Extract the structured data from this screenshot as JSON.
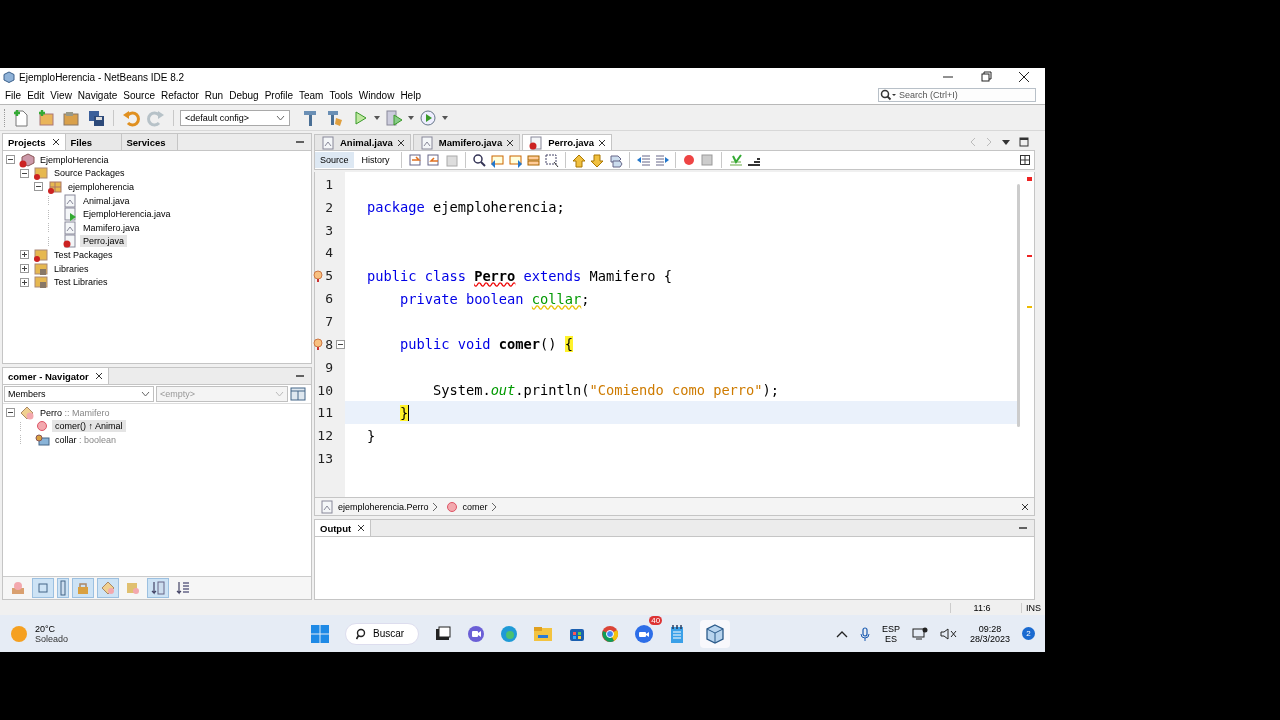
{
  "window": {
    "title": "EjemploHerencia - NetBeans IDE 8.2"
  },
  "menu": [
    "File",
    "Edit",
    "View",
    "Navigate",
    "Source",
    "Refactor",
    "Run",
    "Debug",
    "Profile",
    "Team",
    "Tools",
    "Window",
    "Help"
  ],
  "toolbar": {
    "config": "<default config>",
    "search_placeholder": "Search (Ctrl+I)"
  },
  "projects_panel": {
    "tabs": [
      {
        "label": "Projects",
        "selected": true,
        "closable": true
      },
      {
        "label": "Files",
        "selected": false,
        "closable": false
      },
      {
        "label": "Services",
        "selected": false,
        "closable": false
      }
    ],
    "tree": [
      {
        "label": "EjemploHerencia",
        "kind": "project",
        "expanded": true,
        "selected": false,
        "children": [
          {
            "label": "Source Packages",
            "kind": "folder",
            "expanded": true,
            "selected": false,
            "children": [
              {
                "label": "ejemploherencia",
                "kind": "package",
                "expanded": true,
                "selected": false,
                "children": [
                  {
                    "label": "Animal.java",
                    "kind": "class",
                    "selected": false
                  },
                  {
                    "label": "EjemploHerencia.java",
                    "kind": "main",
                    "selected": false
                  },
                  {
                    "label": "Mamifero.java",
                    "kind": "class",
                    "selected": false
                  },
                  {
                    "label": "Perro.java",
                    "kind": "error",
                    "selected": true
                  }
                ]
              }
            ]
          },
          {
            "label": "Test Packages",
            "kind": "folder",
            "expanded": false,
            "selected": false
          },
          {
            "label": "Libraries",
            "kind": "library",
            "expanded": false,
            "selected": false
          },
          {
            "label": "Test Libraries",
            "kind": "library",
            "expanded": false,
            "selected": false
          }
        ]
      }
    ]
  },
  "navigator": {
    "title": "comer - Navigator",
    "filter": "Members",
    "filter_placeholder": "<empty>",
    "tree": [
      {
        "name": "Perro",
        "detail": " :: Mamifero",
        "kind": "class",
        "expanded": true,
        "selected": false,
        "children": [
          {
            "name": "comer() ↑ Animal",
            "kind": "method",
            "selected": true
          },
          {
            "name": "collar",
            "detail": " : boolean",
            "kind": "field",
            "selected": false
          }
        ]
      }
    ]
  },
  "editor": {
    "tabs": [
      {
        "label": "Animal.java",
        "kind": "class",
        "selected": false
      },
      {
        "label": "Mamifero.java",
        "kind": "class",
        "selected": false
      },
      {
        "label": "Perro.java",
        "kind": "error",
        "selected": true
      }
    ],
    "views": [
      {
        "label": "Source",
        "selected": true
      },
      {
        "label": "History",
        "selected": false
      }
    ],
    "lines": [
      {
        "n": "1"
      },
      {
        "n": "2",
        "tokens": [
          {
            "text": "package",
            "kind": "kw"
          },
          {
            "text": " ejemploherencia;",
            "kind": "plain"
          }
        ]
      },
      {
        "n": "3"
      },
      {
        "n": "4"
      },
      {
        "n": "5",
        "override_marker": true,
        "tokens": [
          {
            "text": "public class ",
            "kind": "kw"
          },
          {
            "text": "Perro",
            "kind": "error"
          },
          {
            "text": " extends",
            "kind": "kw"
          },
          {
            "text": " Mamifero {",
            "kind": "plain"
          }
        ]
      },
      {
        "n": "6",
        "tokens": [
          {
            "text": "    private boolean ",
            "kind": "kw"
          },
          {
            "text": "collar",
            "kind": "field"
          },
          {
            "text": ";",
            "kind": "plain"
          }
        ]
      },
      {
        "n": "7"
      },
      {
        "n": "8",
        "override_marker": true,
        "fold": true,
        "tokens": [
          {
            "text": "    public void ",
            "kind": "kw"
          },
          {
            "text": "comer",
            "kind": "decl"
          },
          {
            "text": "() ",
            "kind": "plain"
          },
          {
            "text": "{",
            "kind": "match"
          }
        ]
      },
      {
        "n": "9"
      },
      {
        "n": "10",
        "tokens": [
          {
            "text": "        System.",
            "kind": "plain"
          },
          {
            "text": "out",
            "kind": "static"
          },
          {
            "text": ".println(",
            "kind": "plain"
          },
          {
            "text": "\"Comiendo como perro\"",
            "kind": "str"
          },
          {
            "text": ");",
            "kind": "plain"
          }
        ]
      },
      {
        "n": "11",
        "current": true,
        "tokens": [
          {
            "text": "    }",
            "kind": "match"
          }
        ]
      },
      {
        "n": "12",
        "tokens": [
          {
            "text": "}",
            "kind": "plain"
          }
        ]
      },
      {
        "n": "13"
      }
    ],
    "breadcrumbs": [
      {
        "label": "ejemploherencia.Perro",
        "kind": "class"
      },
      {
        "label": "comer",
        "kind": "method"
      }
    ]
  },
  "output": {
    "title": "Output"
  },
  "status_bar": {
    "position": "11:6",
    "mode": "INS"
  },
  "taskbar": {
    "temperature": "20°C",
    "weather": "Soleado",
    "search": "Buscar",
    "chat_badge": "40",
    "language": "ESP",
    "layout": "ES",
    "time": "09:28",
    "date": "28/3/2023",
    "notifications": "2"
  }
}
